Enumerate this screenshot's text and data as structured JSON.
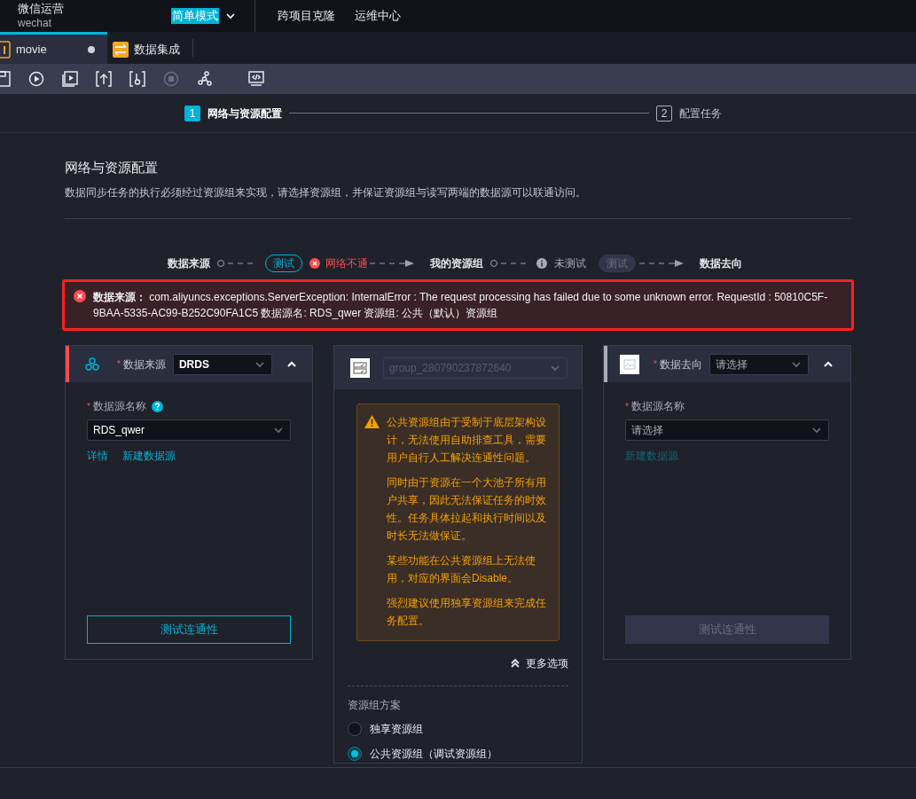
{
  "header": {
    "org_name": "微信运营",
    "org_code": "wechat",
    "mode": "简单模式",
    "nav": [
      "跨项目克隆",
      "运维中心"
    ]
  },
  "tabs": [
    {
      "label": "movie",
      "selected": true,
      "modified": true
    },
    {
      "label": "数据集成",
      "selected": false,
      "modified": false
    }
  ],
  "steps": [
    {
      "number": "1",
      "label": "网络与资源配置",
      "selected": true
    },
    {
      "number": "2",
      "label": "配置任务",
      "selected": false
    }
  ],
  "section": {
    "title": "网络与资源配置",
    "description": "数据同步任务的执行必须经过资源组来实现，请选择资源组，并保证资源组与读写两端的数据源可以联通访问。"
  },
  "flow": [
    {
      "kind": "node",
      "label": "数据来源"
    },
    {
      "kind": "test",
      "label": "测试",
      "disabled": false
    },
    {
      "kind": "status",
      "failed": true,
      "label": "网络不通"
    },
    {
      "kind": "node",
      "label": "我的资源组"
    },
    {
      "kind": "status",
      "failed": false,
      "label": "未测试"
    },
    {
      "kind": "test",
      "label": "测试",
      "disabled": true
    },
    {
      "kind": "node",
      "label": "数据去向"
    }
  ],
  "error": {
    "message": "**数据来源：** com.aliyuncs.exceptions.ServerException: InternalError : The request processing has failed due to some unknown error. RequestId : 50810C5F-9BAA-5335-AC99-B252C90FA1C5 数据源名: RDS_qwer 资源组: 公共（默认）资源组"
  },
  "source": {
    "failed": true,
    "label_mark": "*",
    "label": "数据来源",
    "type_value": "DRDS",
    "expanded": true,
    "field_mark": "*",
    "field_label": "数据源名称",
    "has_help": true,
    "field_value": "RDS_qwer",
    "links": [
      {
        "label": "详情",
        "disabled": false
      },
      {
        "label": "新建数据源",
        "disabled": false
      }
    ],
    "test_button": {
      "label": "测试连通性",
      "disabled": false
    }
  },
  "resource_group": {
    "group": "group_280790237872640",
    "group_disabled": true,
    "warnings": [
      "公共资源组由于受制于底层架构设计，无法使用自助排查工具，需要用户自行人工解决连通性问题。",
      "同时由于资源在一个大池子所有用户共享，因此无法保证任务的时效性。任务具体拉起和执行时间以及时长无法做保证。",
      "某些功能在公共资源组上无法使用，对应的界面会Disable。",
      "强烈建议使用独享资源组来完成任务配置。"
    ],
    "more_options": "更多选项",
    "plan_label": "资源组方案",
    "options": [
      {
        "label": "独享资源组",
        "selected": false
      },
      {
        "label": "公共资源组（调试资源组）",
        "selected": true
      }
    ]
  },
  "target": {
    "failed": false,
    "label_mark": "*",
    "label": "数据去向",
    "type_placeholder": "请选择",
    "expanded": true,
    "field_mark": "*",
    "field_label": "数据源名称",
    "has_help": false,
    "field_placeholder": "请选择",
    "links": [
      {
        "label": "新建数据源",
        "disabled": true
      }
    ],
    "test_button": {
      "label": "测试连通性",
      "disabled": true
    }
  }
}
